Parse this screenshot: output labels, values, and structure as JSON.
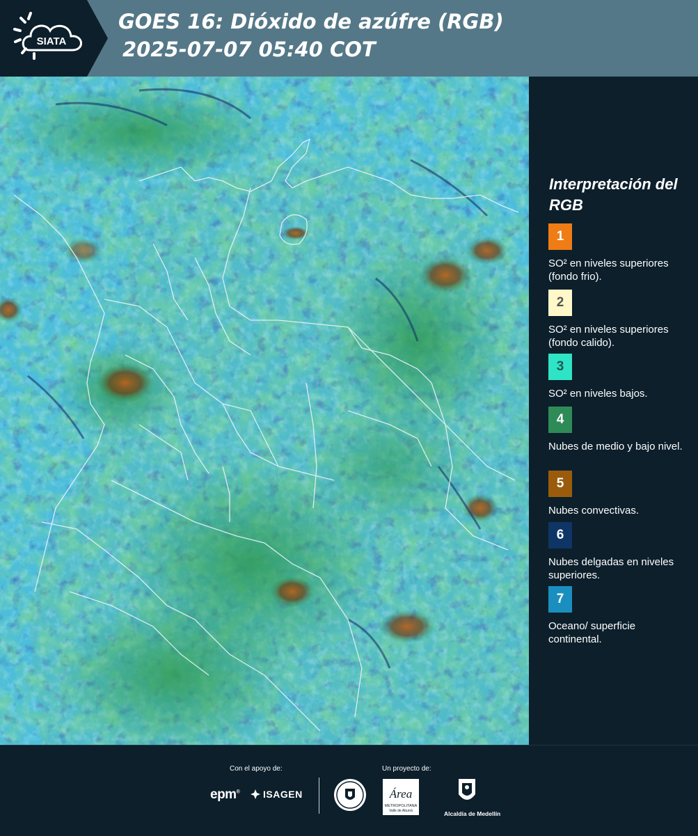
{
  "header": {
    "logo_text": "SIATA",
    "title_line1": "GOES 16: Dióxido de azúfre (RGB)",
    "title_line2": "2025-07-07 05:40 COT",
    "bg_color": "#557888"
  },
  "legend": {
    "title": "Interpretación del RGB",
    "items": [
      {
        "number": "1",
        "color": "#f07c16",
        "text_color": "#ffffff",
        "label": "SO² en niveles superiores (fondo frio)."
      },
      {
        "number": "2",
        "color": "#fff8c8",
        "text_color": "#555555",
        "label": "SO² en niveles superiores (fondo calido)."
      },
      {
        "number": "3",
        "color": "#2fe3c6",
        "text_color": "#1c5a52",
        "label": "SO² en niveles bajos."
      },
      {
        "number": "4",
        "color": "#2e8b57",
        "text_color": "#ffffff",
        "label": "Nubes de medio y bajo nivel."
      },
      {
        "number": "5",
        "color": "#9a5c0c",
        "text_color": "#ffffff",
        "label": "Nubes convectivas."
      },
      {
        "number": "6",
        "color": "#0f3566",
        "text_color": "#ffffff",
        "label": "Nubes delgadas en niveles superiores."
      },
      {
        "number": "7",
        "color": "#1a8fbf",
        "text_color": "#ffffff",
        "label": "Oceano/ superficie continental."
      }
    ]
  },
  "footer": {
    "support_label": "Con el apoyo de:",
    "project_label": "Un proyecto de:",
    "epm_text": "epm",
    "isagen_text": "ISAGEN",
    "area_text": "Área",
    "area_sub": "METROPOLITANA",
    "area_sub2": "Valle de Aburrá",
    "alcaldia_text": "Alcaldía de Medellín"
  },
  "colors": {
    "background": "#0c1f2b",
    "ocean": "#3bb5d6",
    "cloud_green": "#2fa05a",
    "convective": "#8a4a1a"
  }
}
